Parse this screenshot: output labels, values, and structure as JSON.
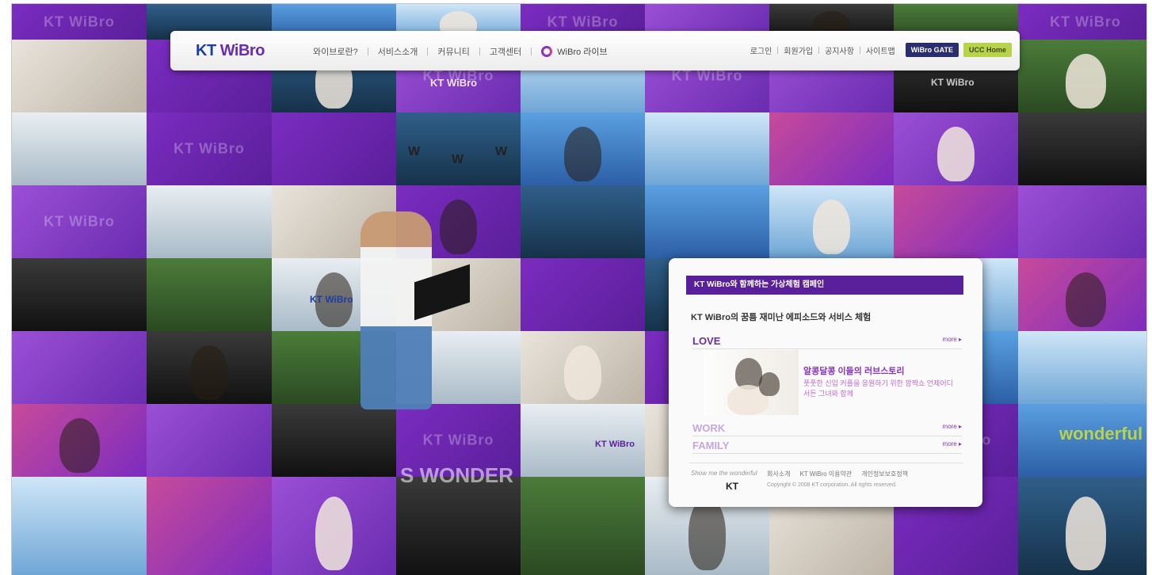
{
  "header": {
    "brand_kt": "KT",
    "brand_wibro": "WiBro",
    "menu": [
      "와이브로란?",
      "서비스소개",
      "커뮤니티",
      "고객센터"
    ],
    "live_label": "WiBro 라이브",
    "util_links": [
      "로그인",
      "회원가입",
      "공지사항",
      "사이트맵"
    ],
    "btn_gate": "WiBro GATE",
    "btn_ucc": "UCC Home"
  },
  "panel": {
    "title": "KT WiBro와 함께하는 가상체험 캠페인",
    "subtitle": "KT WiBro의 꿈틈 재미난 에피소드와 서비스 체험",
    "categories": [
      {
        "label": "LOVE",
        "more": "more ▸"
      },
      {
        "label": "WORK",
        "more": "more ▸"
      },
      {
        "label": "FAMILY",
        "more": "more ▸"
      }
    ],
    "story_title": "알콩달콩 이들의 러브스토리",
    "story_text": "풋풋한 신입 커플을 응원하기 위한 깜짝쇼 언제어디서든 그녀와 함께",
    "footer": {
      "slogan": "Show me the wonderful",
      "kt": "KT",
      "links": [
        "회사소개",
        "KT WiBro 이용약관",
        "개인정보보호정책"
      ],
      "copyright": "Copyright © 2008 KT corporation. All rights reserved."
    }
  },
  "mosaic": {
    "ghost_brand": "KT WiBro",
    "wonder_text": "S WONDER",
    "wonderful_text": "wonderful",
    "jersey_letter": "W"
  },
  "colors": {
    "purple": "#6a2cb0",
    "navy": "#1f3e9e",
    "ucc_green": "#b8d34a"
  }
}
